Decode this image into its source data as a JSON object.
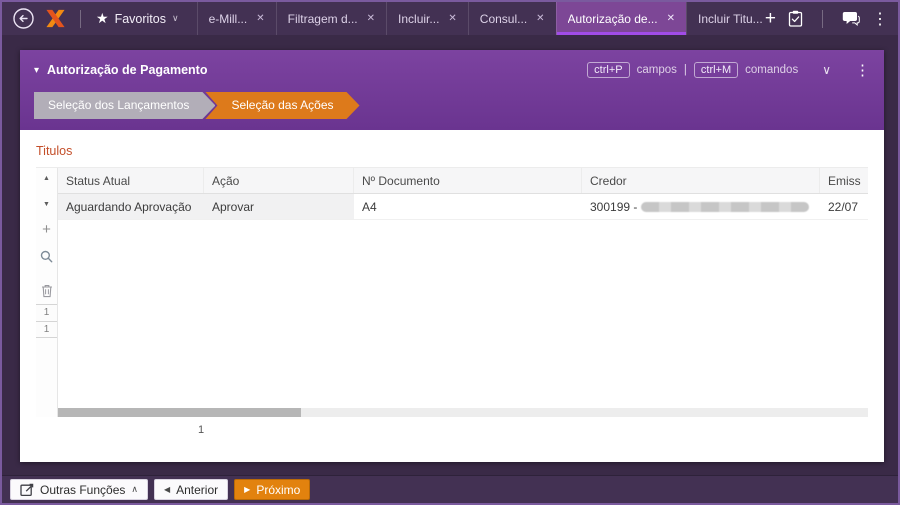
{
  "topbar": {
    "favorites_label": "Favoritos",
    "tabs": [
      {
        "label": "e-Mill..."
      },
      {
        "label": "Filtragem d..."
      },
      {
        "label": "Incluir..."
      },
      {
        "label": "Consul..."
      },
      {
        "label": "Autorização de...",
        "active": true
      },
      {
        "label": "Incluir Titu..."
      }
    ]
  },
  "panel": {
    "title": "Autorização de Pagamento",
    "shortcut_fields_key": "ctrl+P",
    "shortcut_fields_label": "campos",
    "shortcut_separator": "|",
    "shortcut_commands_key": "ctrl+M",
    "shortcut_commands_label": "comandos",
    "steps": [
      {
        "label": "Seleção dos Lançamentos",
        "state": "done"
      },
      {
        "label": "Seleção das Ações",
        "state": "active"
      }
    ]
  },
  "content": {
    "section_title": "Titulos",
    "table": {
      "headers": [
        "Status Atual",
        "Ação",
        "Nº Documento",
        "Credor",
        "Emiss"
      ],
      "row": {
        "status": "Aguardando Aprovação",
        "action": "Aprovar",
        "document": "A4",
        "creditor_prefix": "300199 -",
        "creditor_redacted": true,
        "emission": "22/07"
      },
      "row_numbers": [
        "1",
        "1"
      ],
      "page": "1"
    }
  },
  "footer": {
    "other_functions": "Outras Funções",
    "previous": "Anterior",
    "next": "Próximo"
  },
  "colors": {
    "accent_orange": "#dd7a1b",
    "accent_purple": "#7d4796",
    "active_tab_underline": "#a14ce8",
    "section_title_red": "#c44f2a",
    "step_gray": "#b2aeb8",
    "topbar_bg": "#433153",
    "panel_header_purple": "#6a3490"
  }
}
